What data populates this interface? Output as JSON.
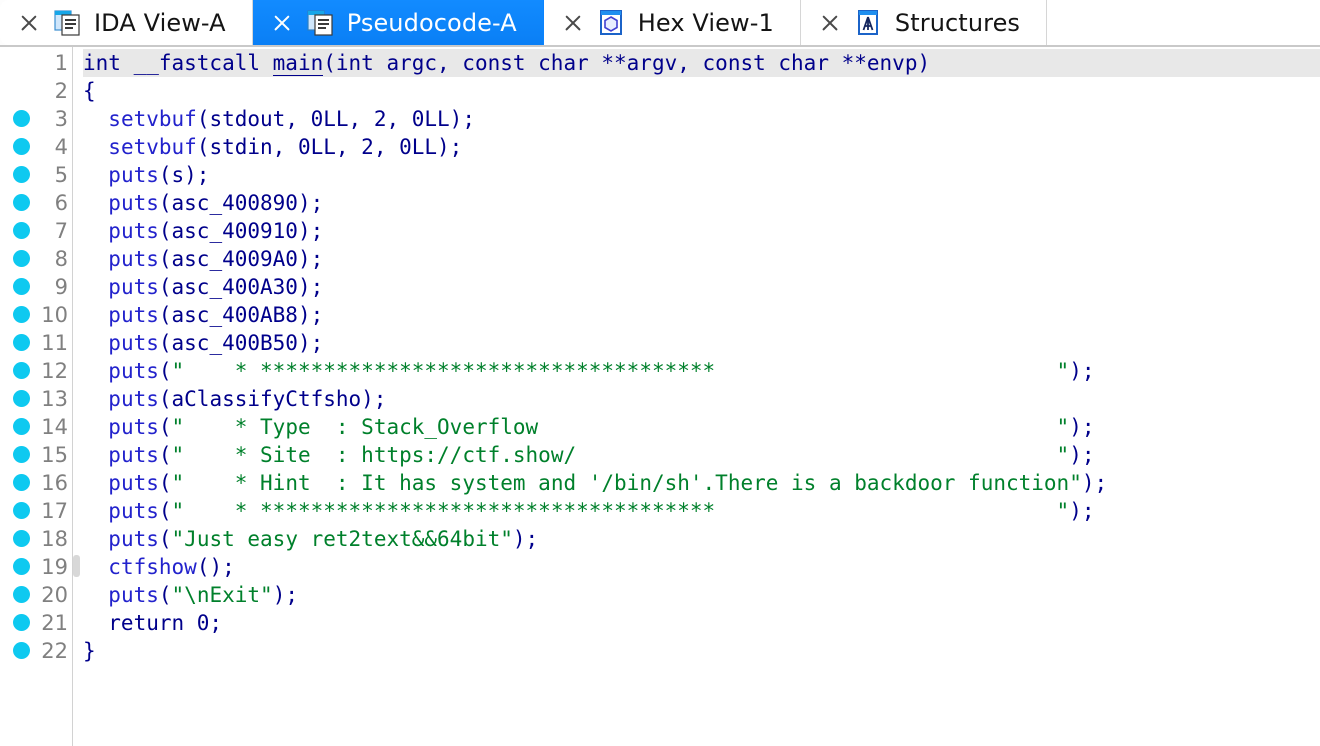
{
  "window": {
    "app": "IDA",
    "view": "Pseudocode-A"
  },
  "tabs": [
    {
      "label": "IDA View-A",
      "icon": "document-pages-icon",
      "active": false,
      "close_icon": "close-icon"
    },
    {
      "label": "Pseudocode-A",
      "icon": "document-pages-icon",
      "active": true,
      "close_icon": "close-icon"
    },
    {
      "label": "Hex View-1",
      "icon": "hex-view-icon",
      "active": false,
      "close_icon": "close-icon"
    },
    {
      "label": "Structures",
      "icon": "structures-icon",
      "active": false,
      "close_icon": "close-icon"
    }
  ],
  "colors": {
    "active_tab_bg": "#0a84ff",
    "breakpoint_dot": "#0ec9f0",
    "line_number": "#808080",
    "code_default": "#00008b",
    "string_literal": "#00802b",
    "function_name": "#2222cc",
    "current_line_bg": "#e8e8e8"
  },
  "editor": {
    "breakpoint_icon": "breakpoint-dot-icon",
    "first_line_number": 1,
    "last_line_number": 22,
    "lines": [
      {
        "num": 1,
        "bp": false,
        "highlight": true,
        "parts": [
          {
            "t": "int __fastcall ",
            "c": "kw"
          },
          {
            "t": "main",
            "c": "def"
          },
          {
            "t": "(int argc, const char **argv, const char **envp)",
            "c": "kw"
          }
        ]
      },
      {
        "num": 2,
        "bp": false,
        "highlight": false,
        "parts": [
          {
            "t": "{",
            "c": "kw"
          }
        ]
      },
      {
        "num": 3,
        "bp": true,
        "highlight": false,
        "parts": [
          {
            "t": "  ",
            "c": "kw"
          },
          {
            "t": "setvbuf",
            "c": "fn"
          },
          {
            "t": "(stdout, 0LL, 2, 0LL);",
            "c": "kw"
          }
        ]
      },
      {
        "num": 4,
        "bp": true,
        "highlight": false,
        "parts": [
          {
            "t": "  ",
            "c": "kw"
          },
          {
            "t": "setvbuf",
            "c": "fn"
          },
          {
            "t": "(stdin, 0LL, 2, 0LL);",
            "c": "kw"
          }
        ]
      },
      {
        "num": 5,
        "bp": true,
        "highlight": false,
        "parts": [
          {
            "t": "  ",
            "c": "kw"
          },
          {
            "t": "puts",
            "c": "fn"
          },
          {
            "t": "(s);",
            "c": "kw"
          }
        ]
      },
      {
        "num": 6,
        "bp": true,
        "highlight": false,
        "parts": [
          {
            "t": "  ",
            "c": "kw"
          },
          {
            "t": "puts",
            "c": "fn"
          },
          {
            "t": "(asc_400890);",
            "c": "kw"
          }
        ]
      },
      {
        "num": 7,
        "bp": true,
        "highlight": false,
        "parts": [
          {
            "t": "  ",
            "c": "kw"
          },
          {
            "t": "puts",
            "c": "fn"
          },
          {
            "t": "(asc_400910);",
            "c": "kw"
          }
        ]
      },
      {
        "num": 8,
        "bp": true,
        "highlight": false,
        "parts": [
          {
            "t": "  ",
            "c": "kw"
          },
          {
            "t": "puts",
            "c": "fn"
          },
          {
            "t": "(asc_4009A0);",
            "c": "kw"
          }
        ]
      },
      {
        "num": 9,
        "bp": true,
        "highlight": false,
        "parts": [
          {
            "t": "  ",
            "c": "kw"
          },
          {
            "t": "puts",
            "c": "fn"
          },
          {
            "t": "(asc_400A30);",
            "c": "kw"
          }
        ]
      },
      {
        "num": 10,
        "bp": true,
        "highlight": false,
        "parts": [
          {
            "t": "  ",
            "c": "kw"
          },
          {
            "t": "puts",
            "c": "fn"
          },
          {
            "t": "(asc_400AB8);",
            "c": "kw"
          }
        ]
      },
      {
        "num": 11,
        "bp": true,
        "highlight": false,
        "parts": [
          {
            "t": "  ",
            "c": "kw"
          },
          {
            "t": "puts",
            "c": "fn"
          },
          {
            "t": "(asc_400B50);",
            "c": "kw"
          }
        ]
      },
      {
        "num": 12,
        "bp": true,
        "highlight": false,
        "parts": [
          {
            "t": "  ",
            "c": "kw"
          },
          {
            "t": "puts",
            "c": "fn"
          },
          {
            "t": "(",
            "c": "kw"
          },
          {
            "t": "\"    * ************************************                           \"",
            "c": "str"
          },
          {
            "t": ");",
            "c": "kw"
          }
        ]
      },
      {
        "num": 13,
        "bp": true,
        "highlight": false,
        "parts": [
          {
            "t": "  ",
            "c": "kw"
          },
          {
            "t": "puts",
            "c": "fn"
          },
          {
            "t": "(aClassifyCtfsho);",
            "c": "kw"
          }
        ]
      },
      {
        "num": 14,
        "bp": true,
        "highlight": false,
        "parts": [
          {
            "t": "  ",
            "c": "kw"
          },
          {
            "t": "puts",
            "c": "fn"
          },
          {
            "t": "(",
            "c": "kw"
          },
          {
            "t": "\"    * Type  : Stack_Overflow                                         \"",
            "c": "str"
          },
          {
            "t": ");",
            "c": "kw"
          }
        ]
      },
      {
        "num": 15,
        "bp": true,
        "highlight": false,
        "parts": [
          {
            "t": "  ",
            "c": "kw"
          },
          {
            "t": "puts",
            "c": "fn"
          },
          {
            "t": "(",
            "c": "kw"
          },
          {
            "t": "\"    * Site  : https://ctf.show/                                      \"",
            "c": "str"
          },
          {
            "t": ");",
            "c": "kw"
          }
        ]
      },
      {
        "num": 16,
        "bp": true,
        "highlight": false,
        "parts": [
          {
            "t": "  ",
            "c": "kw"
          },
          {
            "t": "puts",
            "c": "fn"
          },
          {
            "t": "(",
            "c": "kw"
          },
          {
            "t": "\"    * Hint  : It has system and '/bin/sh'.There is a backdoor function\"",
            "c": "str"
          },
          {
            "t": ");",
            "c": "kw"
          }
        ]
      },
      {
        "num": 17,
        "bp": true,
        "highlight": false,
        "parts": [
          {
            "t": "  ",
            "c": "kw"
          },
          {
            "t": "puts",
            "c": "fn"
          },
          {
            "t": "(",
            "c": "kw"
          },
          {
            "t": "\"    * ************************************                           \"",
            "c": "str"
          },
          {
            "t": ");",
            "c": "kw"
          }
        ]
      },
      {
        "num": 18,
        "bp": true,
        "highlight": false,
        "parts": [
          {
            "t": "  ",
            "c": "kw"
          },
          {
            "t": "puts",
            "c": "fn"
          },
          {
            "t": "(",
            "c": "kw"
          },
          {
            "t": "\"Just easy ret2text&&64bit\"",
            "c": "str"
          },
          {
            "t": ");",
            "c": "kw"
          }
        ]
      },
      {
        "num": 19,
        "bp": true,
        "highlight": false,
        "parts": [
          {
            "t": "  ",
            "c": "kw"
          },
          {
            "t": "ctfshow",
            "c": "fn"
          },
          {
            "t": "();",
            "c": "kw"
          }
        ]
      },
      {
        "num": 20,
        "bp": true,
        "highlight": false,
        "parts": [
          {
            "t": "  ",
            "c": "kw"
          },
          {
            "t": "puts",
            "c": "fn"
          },
          {
            "t": "(",
            "c": "kw"
          },
          {
            "t": "\"\\nExit\"",
            "c": "str"
          },
          {
            "t": ");",
            "c": "kw"
          }
        ]
      },
      {
        "num": 21,
        "bp": true,
        "highlight": false,
        "parts": [
          {
            "t": "  return 0;",
            "c": "kw"
          }
        ]
      },
      {
        "num": 22,
        "bp": true,
        "highlight": false,
        "parts": [
          {
            "t": "}",
            "c": "kw"
          }
        ]
      }
    ]
  },
  "scrollbar": {
    "vertical_thumb_present": true
  }
}
